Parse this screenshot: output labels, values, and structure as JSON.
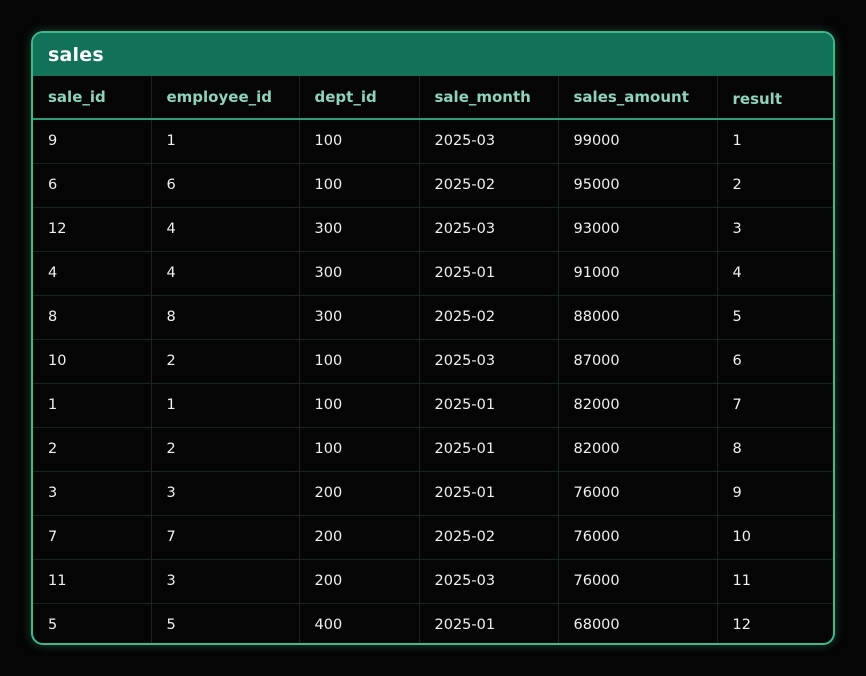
{
  "table": {
    "title": "sales",
    "columns": [
      "sale_id",
      "employee_id",
      "dept_id",
      "sale_month",
      "sales_amount",
      "result"
    ],
    "rows": [
      [
        "9",
        "1",
        "100",
        "2025-03",
        "99000",
        "1"
      ],
      [
        "6",
        "6",
        "100",
        "2025-02",
        "95000",
        "2"
      ],
      [
        "12",
        "4",
        "300",
        "2025-03",
        "93000",
        "3"
      ],
      [
        "4",
        "4",
        "300",
        "2025-01",
        "91000",
        "4"
      ],
      [
        "8",
        "8",
        "300",
        "2025-02",
        "88000",
        "5"
      ],
      [
        "10",
        "2",
        "100",
        "2025-03",
        "87000",
        "6"
      ],
      [
        "1",
        "1",
        "100",
        "2025-01",
        "82000",
        "7"
      ],
      [
        "2",
        "2",
        "100",
        "2025-01",
        "82000",
        "8"
      ],
      [
        "3",
        "3",
        "200",
        "2025-01",
        "76000",
        "9"
      ],
      [
        "7",
        "7",
        "200",
        "2025-02",
        "76000",
        "10"
      ],
      [
        "11",
        "3",
        "200",
        "2025-03",
        "76000",
        "11"
      ],
      [
        "5",
        "5",
        "400",
        "2025-01",
        "68000",
        "12"
      ]
    ]
  },
  "colors": {
    "accent": "#3fb98a",
    "header_bg": "#117159",
    "column_header_text": "#8fd3bb",
    "background": "#050505",
    "cell_text": "#f0f0f0"
  }
}
